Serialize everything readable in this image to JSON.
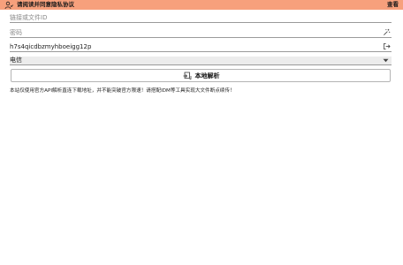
{
  "banner": {
    "icon": "agreement-person-icon",
    "text": "请阅读并同意隐私协议",
    "link": "查看"
  },
  "fields": {
    "link": {
      "placeholder": "链接或文件ID",
      "value": ""
    },
    "password": {
      "placeholder": "密码",
      "value": "",
      "icon": "magic-wand-icon"
    },
    "token": {
      "placeholder": "",
      "value": "h7s4qicdbzmyhboeigg12p",
      "icon": "login-icon"
    }
  },
  "provider": {
    "selected": "电信",
    "icon": "chevron-down-icon"
  },
  "parse_button": {
    "label": "本地解析",
    "icon": "local-parse-icon"
  },
  "notice": "本站仅使用官方API解析直连下载地址，并不能突破官方限速！请搭配IDM等工具实现大文件断点续传！",
  "colors": {
    "banner_bg": "#f7a07c",
    "field_line": "#9a9a9a",
    "select_bg": "#ececec"
  }
}
